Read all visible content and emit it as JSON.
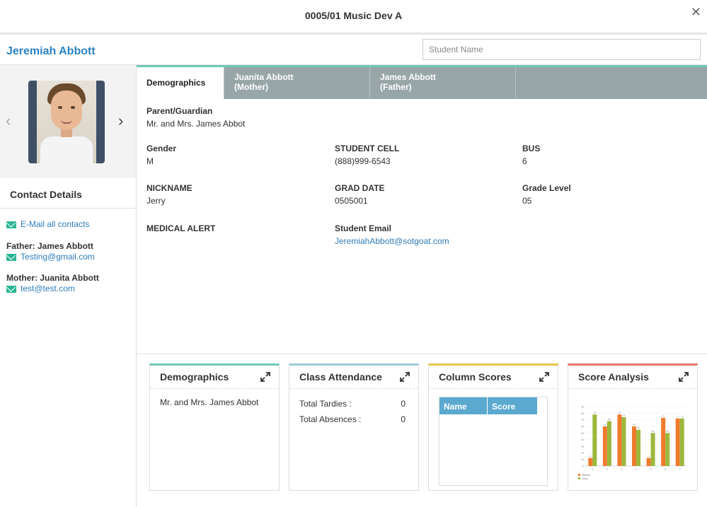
{
  "window": {
    "title": "0005/01 Music Dev A",
    "close_label": "✕"
  },
  "header": {
    "student_name": "Jeremiah Abbott",
    "search_placeholder": "Student Name"
  },
  "photo_nav": {
    "prev": "‹",
    "next": "›"
  },
  "contacts": {
    "title": "Contact Details",
    "email_all": "E-Mail all contacts",
    "father_label": "Father: James Abbott",
    "father_email": "Testing@gmail.com",
    "mother_label": "Mother: Juanita Abbott",
    "mother_email": "test@test.com"
  },
  "tabs": [
    {
      "label": "Demographics",
      "sub": ""
    },
    {
      "label": "Juanita Abbott",
      "sub": "(Mother)"
    },
    {
      "label": "James Abbott",
      "sub": "(Father)"
    }
  ],
  "demographics": {
    "parent_guardian": {
      "label": "Parent/Guardian",
      "value": "Mr. and Mrs. James Abbot"
    },
    "gender": {
      "label": "Gender",
      "value": "M"
    },
    "student_cell": {
      "label": "STUDENT CELL",
      "value": "(888)999-6543"
    },
    "bus": {
      "label": "BUS",
      "value": "6"
    },
    "nickname": {
      "label": "NICKNAME",
      "value": "Jerry"
    },
    "grad_date": {
      "label": "GRAD DATE",
      "value": "0505001"
    },
    "grade_level": {
      "label": "Grade Level",
      "value": "05"
    },
    "medical_alert": {
      "label": "MEDICAL ALERT",
      "value": ""
    },
    "student_email": {
      "label": "Student Email",
      "value": "JeremiahAbbott@sotgoat.com"
    }
  },
  "cards": {
    "demographics": {
      "title": "Demographics",
      "text": "Mr. and Mrs. James Abbot",
      "color": "#6ec9b5"
    },
    "attendance": {
      "title": "Class Attendance",
      "tardies_label": "Total Tardies :",
      "tardies": "0",
      "absences_label": "Total Absences :",
      "absences": "0",
      "color": "#9ccbd6"
    },
    "column_scores": {
      "title": "Column Scores",
      "col_name": "Name",
      "col_score": "Score",
      "color": "#e8c547"
    },
    "score_analysis": {
      "title": "Score Analysis",
      "color": "#e8776a"
    }
  },
  "colors": {
    "accent_blue": "#2b82c4",
    "link": "#2e7cb8",
    "tab_bar": "#99a6a8",
    "mail_icon": "#2bb596"
  },
  "chart_data": {
    "type": "bar",
    "categories": [
      "1",
      "2",
      "3",
      "4",
      "5",
      "6",
      "7"
    ],
    "series": [
      {
        "name": "Student",
        "values": [
          12,
          60,
          78,
          60,
          12,
          73,
          72
        ]
      },
      {
        "name": "Class",
        "values": [
          78,
          68,
          74,
          55,
          50,
          50,
          72
        ]
      }
    ],
    "ylim": [
      0,
      90
    ],
    "colors": [
      "#f07b2c",
      "#9cb83c"
    ],
    "legend": "bottom-left"
  }
}
